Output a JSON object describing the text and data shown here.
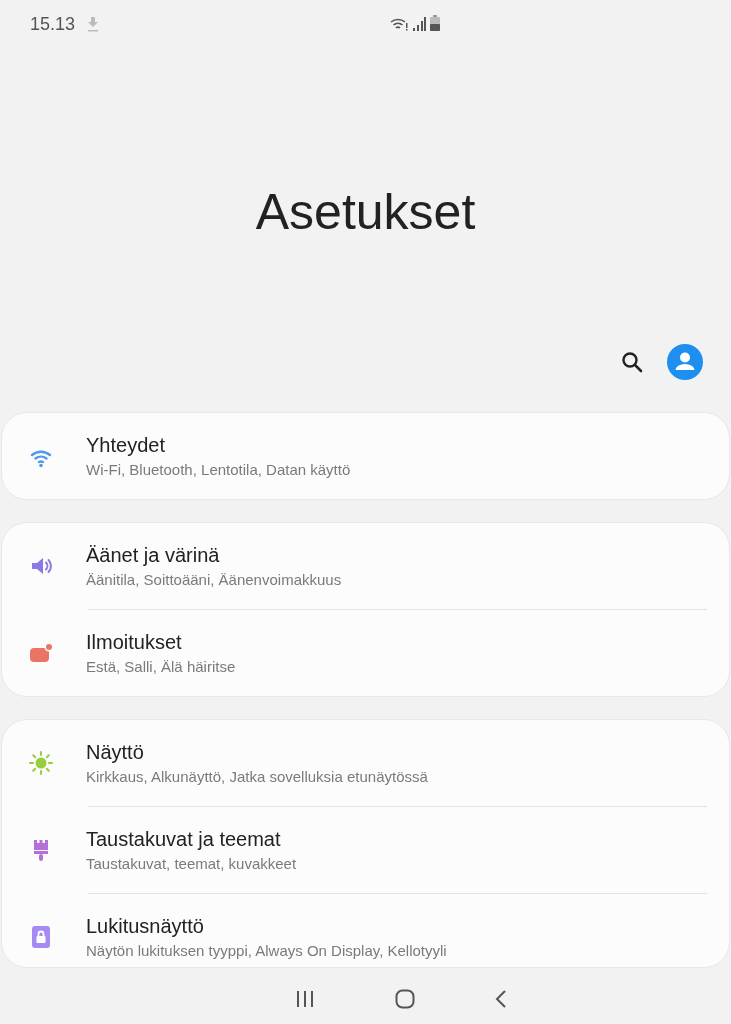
{
  "status_bar": {
    "time": "15.13"
  },
  "title": "Asetukset",
  "groups": [
    {
      "items": [
        {
          "kind": "wifi",
          "color": "#4e9ae8",
          "title": "Yhteydet",
          "subtitle": "Wi-Fi, Bluetooth, Lentotila, Datan käyttö"
        }
      ]
    },
    {
      "items": [
        {
          "kind": "sound",
          "color": "#8b78e6",
          "title": "Äänet ja värinä",
          "subtitle": "Äänitila, Soittoääni, Äänenvoimakkuus"
        },
        {
          "kind": "notification",
          "color": "#ec7465",
          "title": "Ilmoitukset",
          "subtitle": "Estä, Salli, Älä häiritse"
        }
      ]
    },
    {
      "items": [
        {
          "kind": "display",
          "color": "#9acd3c",
          "title": "Näyttö",
          "subtitle": "Kirkkaus, Alkunäyttö, Jatka sovelluksia etunäytössä"
        },
        {
          "kind": "brush",
          "color": "#b56fd8",
          "title": "Taustakuvat ja teemat",
          "subtitle": "Taustakuvat, teemat, kuvakkeet"
        },
        {
          "kind": "lock",
          "color": "#a48af2",
          "title": "Lukitusnäyttö",
          "subtitle": "Näytön lukituksen tyyppi, Always On Display, Kellotyyli"
        }
      ]
    }
  ]
}
